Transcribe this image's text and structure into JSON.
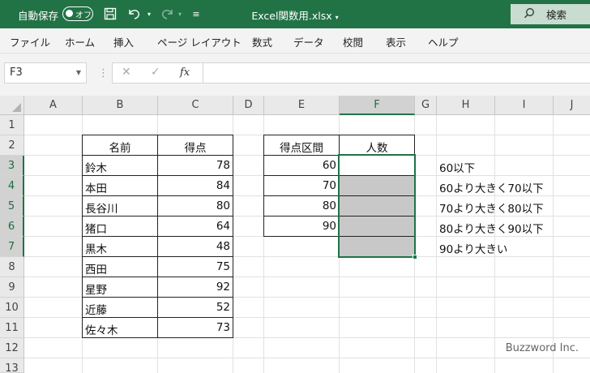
{
  "titlebar": {
    "autosave_label": "自動保存",
    "autosave_state": "オフ",
    "file_title": "Excel関数用.xlsx",
    "search_label": "検索"
  },
  "ribbon": {
    "tabs": [
      "ファイル",
      "ホーム",
      "挿入",
      "ページ レイアウト",
      "数式",
      "データ",
      "校閲",
      "表示",
      "ヘルプ"
    ]
  },
  "formula_bar": {
    "name_box": "F3",
    "fx": "fx",
    "content": ""
  },
  "sheet": {
    "columns": [
      "A",
      "B",
      "C",
      "D",
      "E",
      "F",
      "G",
      "H",
      "I",
      "J"
    ],
    "rows": [
      "1",
      "2",
      "3",
      "4",
      "5",
      "6",
      "7",
      "8",
      "9",
      "10",
      "11",
      "12",
      "13"
    ],
    "active_cell": "F3",
    "score_table": {
      "headers": [
        "名前",
        "得点"
      ],
      "rows": [
        [
          "鈴木",
          "78"
        ],
        [
          "本田",
          "84"
        ],
        [
          "長谷川",
          "80"
        ],
        [
          "猪口",
          "64"
        ],
        [
          "黒木",
          "48"
        ],
        [
          "西田",
          "75"
        ],
        [
          "星野",
          "92"
        ],
        [
          "近藤",
          "52"
        ],
        [
          "佐々木",
          "73"
        ]
      ]
    },
    "range_table": {
      "headers": [
        "得点区間",
        "人数"
      ],
      "bins": [
        "60",
        "70",
        "80",
        "90",
        ""
      ]
    },
    "notes": [
      "60以下",
      "60より大きく70以下",
      "70より大きく80以下",
      "80より大きく90以下",
      "90より大きい"
    ]
  },
  "watermark": "Buzzword Inc."
}
